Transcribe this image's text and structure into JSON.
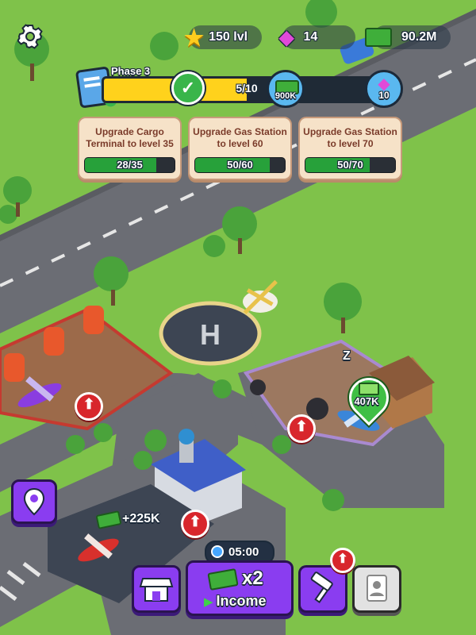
{
  "topbar": {
    "level_text": "150 lvl",
    "gems_text": "14",
    "cash_text": "90.2M"
  },
  "phase": {
    "label": "Phase 3",
    "progress_text": "5/10",
    "progress": 0.5,
    "reward_cash": "900K",
    "reward_gems": "10"
  },
  "quests": [
    {
      "title": "Upgrade Cargo Terminal to level 35",
      "progress_text": "28/35",
      "progress": 0.8
    },
    {
      "title": "Upgrade Gas Station to level 60",
      "progress_text": "50/60",
      "progress": 0.833
    },
    {
      "title": "Upgrade Gas Station to level 70",
      "progress_text": "50/70",
      "progress": 0.714
    }
  ],
  "world": {
    "helipad_letter": "H",
    "hangar_income": "407K",
    "terminal_income": "+225K",
    "sleep_z": "Z"
  },
  "bottom": {
    "timer": "05:00",
    "multiplier": "x2",
    "income_label": "Income"
  },
  "colors": {
    "accent_purple": "#8a3df0",
    "grass": "#7fc24a",
    "road": "#6e6e72",
    "progress_green": "#27a13a",
    "phase_yellow": "#ffd21c"
  }
}
